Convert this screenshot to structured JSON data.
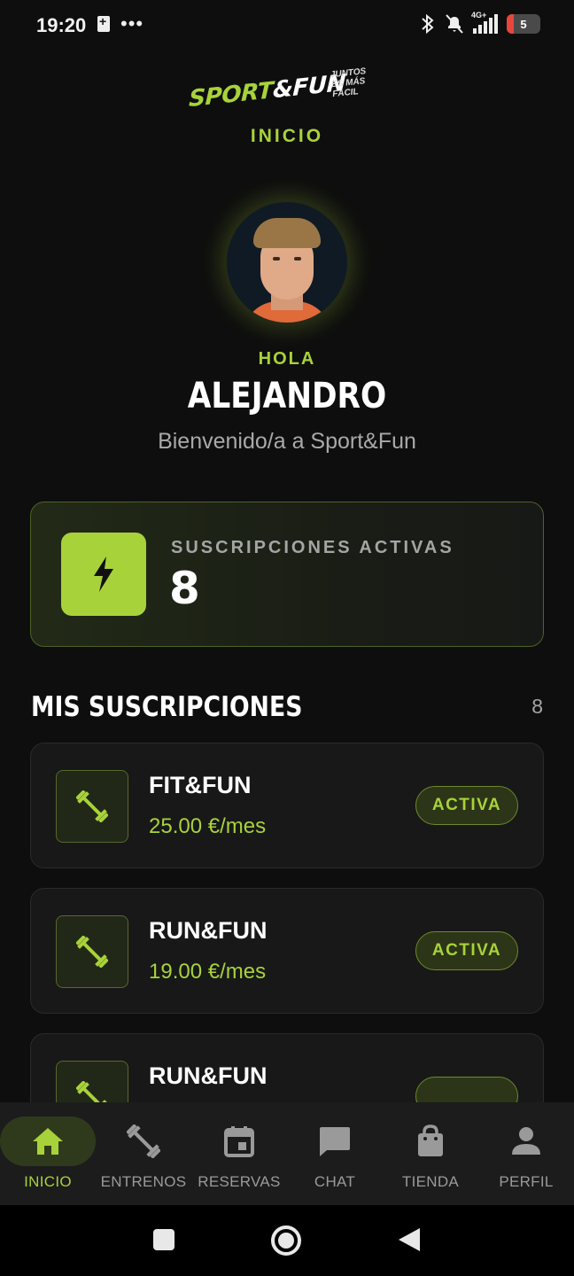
{
  "status_bar": {
    "time": "19:20",
    "network": "4G+",
    "battery_level": "5"
  },
  "header": {
    "brand": "SPORT&FUN",
    "brand_part1": "SPORT",
    "brand_part2": "&FUN",
    "tagline_line1": "JUNTOS",
    "tagline_line2": "ES MÁS FÁCIL",
    "page_title": "INICIO"
  },
  "greeting": {
    "hello": "HOLA",
    "name": "ALEJANDRO",
    "welcome": "Bienvenido/a a Sport&Fun"
  },
  "active_card": {
    "label": "SUSCRIPCIONES ACTIVAS",
    "count": "8",
    "icon": "bolt-icon"
  },
  "subscriptions": {
    "title": "MIS SUSCRIPCIONES",
    "count": "8",
    "items": [
      {
        "name": "FIT&FUN",
        "price": "25.00 €/mes",
        "status": "ACTIVA",
        "icon": "dumbbell-icon"
      },
      {
        "name": "RUN&FUN",
        "price": "19.00 €/mes",
        "status": "ACTIVA",
        "icon": "dumbbell-icon"
      },
      {
        "name": "RUN&FUN",
        "icon": "dumbbell-icon"
      }
    ]
  },
  "nav": {
    "items": [
      {
        "label": "INICIO",
        "icon": "home-icon",
        "active": true
      },
      {
        "label": "ENTRENOS",
        "icon": "dumbbell-icon"
      },
      {
        "label": "RESERVAS",
        "icon": "calendar-icon"
      },
      {
        "label": "CHAT",
        "icon": "chat-icon"
      },
      {
        "label": "TIENDA",
        "icon": "shopping-bag-icon"
      },
      {
        "label": "PERFIL",
        "icon": "person-icon"
      }
    ]
  },
  "colors": {
    "accent": "#a8d23a",
    "background": "#0e0e0e",
    "card": "#181818",
    "nav_background": "#1c1c1c"
  }
}
